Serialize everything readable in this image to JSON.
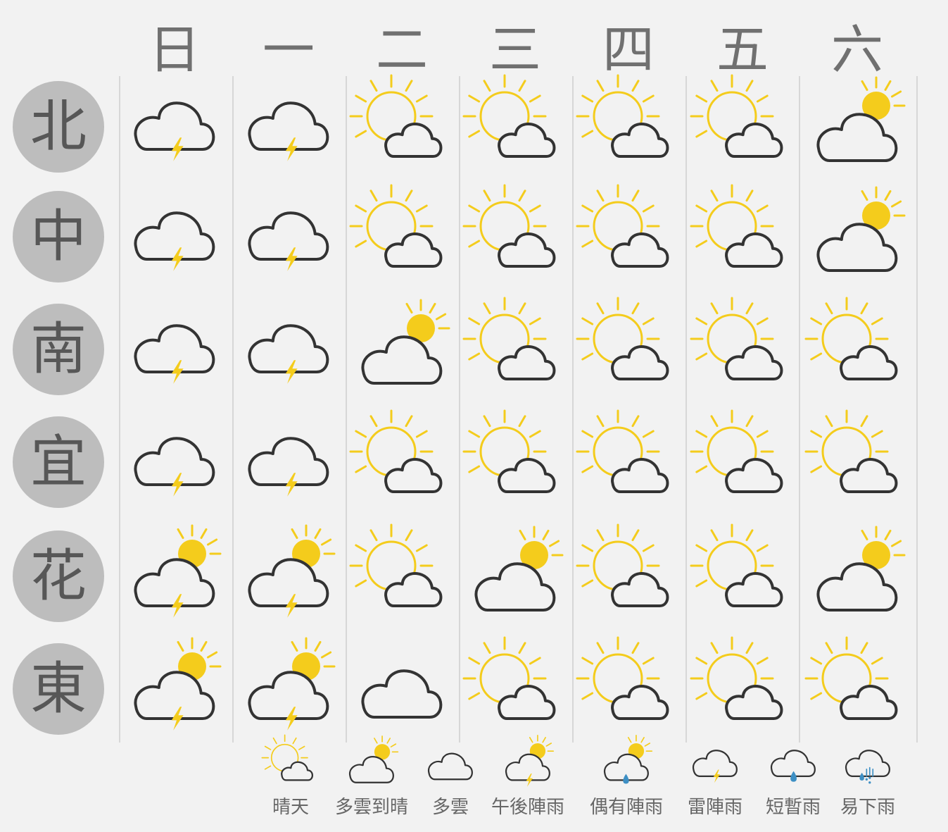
{
  "days": [
    "日",
    "一",
    "二",
    "三",
    "四",
    "五",
    "六"
  ],
  "regions": [
    "北",
    "中",
    "南",
    "宜",
    "花",
    "東"
  ],
  "icon_types": {
    "sunny_cloudy": "晴天",
    "cloudy_clearing": "多雲到晴",
    "cloudy": "多雲",
    "afternoon_showers": "午後陣雨",
    "occasional_showers": "偶有陣雨",
    "thundershower": "雷陣雨",
    "brief_rain": "短暫雨",
    "rain_prone": "易下雨"
  },
  "forecast": [
    [
      "thundershower",
      "thundershower",
      "sunny_cloudy",
      "sunny_cloudy",
      "sunny_cloudy",
      "sunny_cloudy",
      "cloudy_clearing"
    ],
    [
      "thundershower",
      "thundershower",
      "sunny_cloudy",
      "sunny_cloudy",
      "sunny_cloudy",
      "sunny_cloudy",
      "cloudy_clearing"
    ],
    [
      "thundershower",
      "thundershower",
      "cloudy_clearing",
      "sunny_cloudy",
      "sunny_cloudy",
      "sunny_cloudy",
      "sunny_cloudy"
    ],
    [
      "thundershower",
      "thundershower",
      "sunny_cloudy",
      "sunny_cloudy",
      "sunny_cloudy",
      "sunny_cloudy",
      "sunny_cloudy"
    ],
    [
      "afternoon_showers",
      "afternoon_showers",
      "sunny_cloudy",
      "cloudy_clearing",
      "sunny_cloudy",
      "sunny_cloudy",
      "cloudy_clearing"
    ],
    [
      "afternoon_showers",
      "afternoon_showers",
      "cloudy",
      "sunny_cloudy",
      "sunny_cloudy",
      "sunny_cloudy",
      "sunny_cloudy"
    ]
  ],
  "legend": [
    {
      "type": "sunny_cloudy",
      "label": "晴天"
    },
    {
      "type": "cloudy_clearing",
      "label": "多雲到晴"
    },
    {
      "type": "cloudy",
      "label": "多雲"
    },
    {
      "type": "afternoon_showers",
      "label": "午後陣雨"
    },
    {
      "type": "occasional_showers",
      "label": "偶有陣雨"
    },
    {
      "type": "thundershower",
      "label": "雷陣雨"
    },
    {
      "type": "brief_rain",
      "label": "短暫雨"
    },
    {
      "type": "rain_prone",
      "label": "易下雨"
    }
  ],
  "colors": {
    "background": "#f2f2f2",
    "sun": "#f4cc1c",
    "cloud_outline": "#333333",
    "lightning": "#f4cc1c",
    "rain": "#3d8fc4",
    "region_circle": "#bdbdbd",
    "region_text": "#575757",
    "header_text": "#707070"
  }
}
